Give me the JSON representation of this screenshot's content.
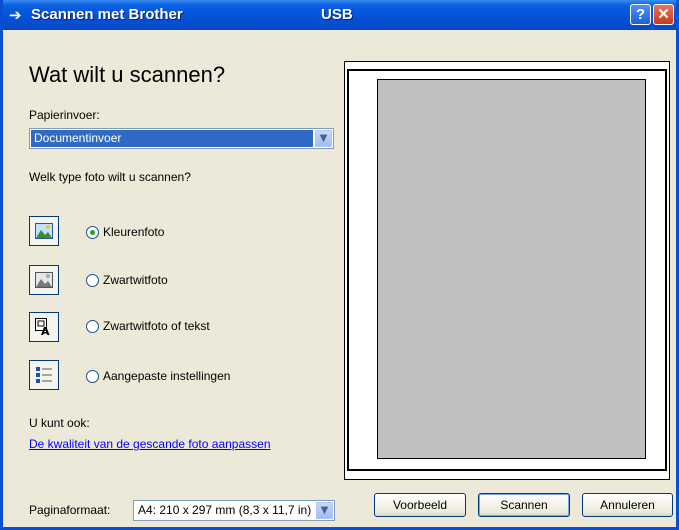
{
  "window": {
    "title": "Scannen met Brother",
    "connection": "USB",
    "help_label": "?",
    "close_label": "✕",
    "title_arrow": "➔"
  },
  "heading": "Wat wilt u scannen?",
  "paper_input": {
    "label": "Papierinvoer:",
    "selected": "Documentinvoer",
    "arrow": "▼"
  },
  "photo_type": {
    "question": "Welk type foto wilt u scannen?",
    "options": [
      {
        "label": "Kleurenfoto",
        "icon": "color-photo-icon",
        "selected": true
      },
      {
        "label": "Zwartwitfoto",
        "icon": "grayscale-photo-icon",
        "selected": false
      },
      {
        "label": "Zwartwitfoto of tekst",
        "icon": "text-document-icon",
        "selected": false
      },
      {
        "label": "Aangepaste instellingen",
        "icon": "custom-settings-icon",
        "selected": false
      }
    ]
  },
  "also": {
    "label": "U kunt ook:",
    "link": "De kwaliteit van de gescande foto aanpassen"
  },
  "page_size": {
    "label": "Paginaformaat:",
    "value": "A4: 210 x 297 mm (8,3 x 11,7 in)",
    "arrow": "▼"
  },
  "buttons": {
    "preview": "Voorbeeld",
    "scan": "Scannen",
    "cancel": "Annuleren"
  },
  "colors": {
    "titlebar": "#0551d8",
    "window_bg": "#ece9d8",
    "selection": "#316ac5",
    "preview_area": "#c0c0c0",
    "link": "#0000ff"
  }
}
